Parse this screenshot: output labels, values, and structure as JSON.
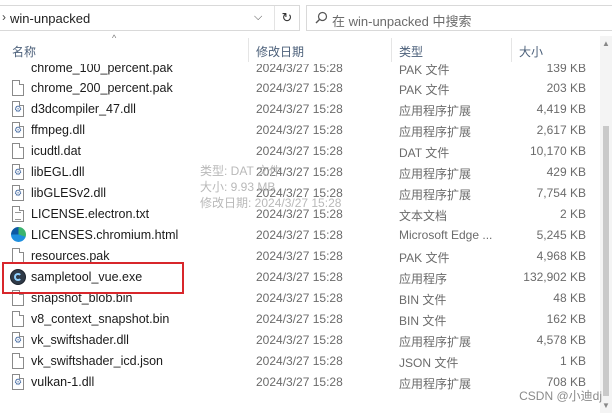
{
  "address": {
    "path": "win-unpacked",
    "separator": "›",
    "dropdown": "⌵",
    "refresh": "↻"
  },
  "search": {
    "placeholder": "在 win-unpacked 中搜索"
  },
  "columns": {
    "name": "名称",
    "date": "修改日期",
    "type": "类型",
    "size": "大小",
    "sort_caret": "^"
  },
  "files": [
    {
      "name": "chrome_100_percent.pak",
      "date": "2024/3/27 15:28",
      "type": "PAK 文件",
      "size": "139 KB",
      "icon": "file-icon"
    },
    {
      "name": "chrome_200_percent.pak",
      "date": "2024/3/27 15:28",
      "type": "PAK 文件",
      "size": "203 KB",
      "icon": "file-icon"
    },
    {
      "name": "d3dcompiler_47.dll",
      "date": "2024/3/27 15:28",
      "type": "应用程序扩展",
      "size": "4,419 KB",
      "icon": "dll-icon"
    },
    {
      "name": "ffmpeg.dll",
      "date": "2024/3/27 15:28",
      "type": "应用程序扩展",
      "size": "2,617 KB",
      "icon": "dll-icon"
    },
    {
      "name": "icudtl.dat",
      "date": "2024/3/27 15:28",
      "type": "DAT 文件",
      "size": "10,170 KB",
      "icon": "file-icon"
    },
    {
      "name": "libEGL.dll",
      "date": "2024/3/27 15:28",
      "type": "应用程序扩展",
      "size": "429 KB",
      "icon": "dll-icon"
    },
    {
      "name": "libGLESv2.dll",
      "date": "2024/3/27 15:28",
      "type": "应用程序扩展",
      "size": "7,754 KB",
      "icon": "dll-icon"
    },
    {
      "name": "LICENSE.electron.txt",
      "date": "2024/3/27 15:28",
      "type": "文本文档",
      "size": "2 KB",
      "icon": "text-file-icon"
    },
    {
      "name": "LICENSES.chromium.html",
      "date": "2024/3/27 15:28",
      "type": "Microsoft Edge ...",
      "size": "5,245 KB",
      "icon": "edge-icon"
    },
    {
      "name": "resources.pak",
      "date": "2024/3/27 15:28",
      "type": "PAK 文件",
      "size": "4,968 KB",
      "icon": "file-icon"
    },
    {
      "name": "sampletool_vue.exe",
      "date": "2024/3/27 15:28",
      "type": "应用程序",
      "size": "132,902 KB",
      "icon": "app-icon"
    },
    {
      "name": "snapshot_blob.bin",
      "date": "2024/3/27 15:28",
      "type": "BIN 文件",
      "size": "48 KB",
      "icon": "file-icon"
    },
    {
      "name": "v8_context_snapshot.bin",
      "date": "2024/3/27 15:28",
      "type": "BIN 文件",
      "size": "162 KB",
      "icon": "file-icon"
    },
    {
      "name": "vk_swiftshader.dll",
      "date": "2024/3/27 15:28",
      "type": "应用程序扩展",
      "size": "4,578 KB",
      "icon": "dll-icon"
    },
    {
      "name": "vk_swiftshader_icd.json",
      "date": "2024/3/27 15:28",
      "type": "JSON 文件",
      "size": "1 KB",
      "icon": "file-icon"
    },
    {
      "name": "vulkan-1.dll",
      "date": "2024/3/27 15:28",
      "type": "应用程序扩展",
      "size": "708 KB",
      "icon": "dll-icon"
    }
  ],
  "tooltip": {
    "type_line": "类型: DAT 文件",
    "size_line": "大小: 9.93 MB",
    "date_line": "修改日期: 2024/3/27 15:28"
  },
  "watermark": "CSDN @小迪dj",
  "colors": {
    "highlight": "#d8262b",
    "header_text": "#4c607a"
  }
}
